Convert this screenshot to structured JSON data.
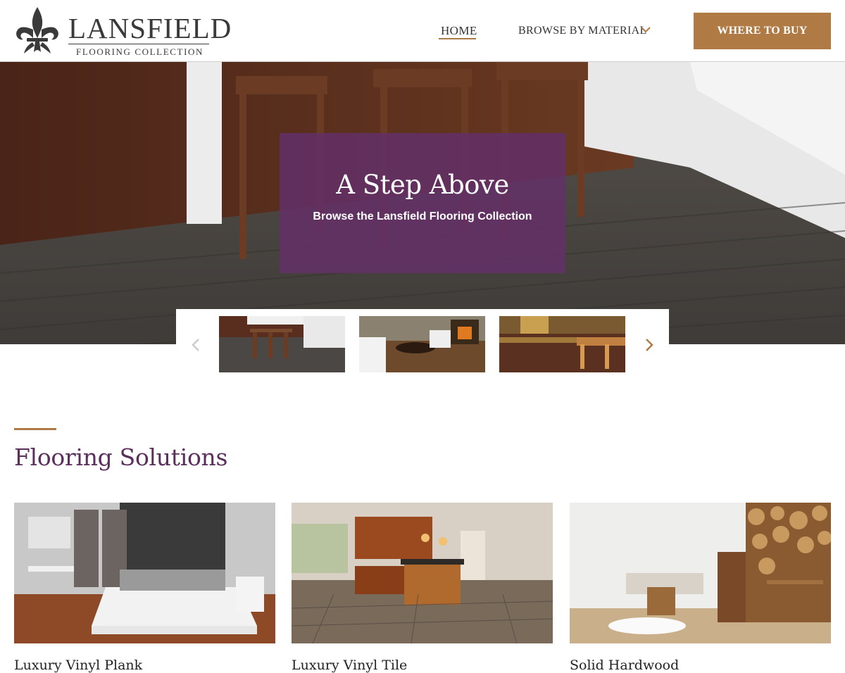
{
  "brand": {
    "name": "LANSFIELD",
    "tagline": "FLOORING COLLECTION"
  },
  "nav": {
    "home": "HOME",
    "browse": "BROWSE BY MATERIAL",
    "where_to_buy": "WHERE TO BUY"
  },
  "hero": {
    "title": "A Step Above",
    "subtitle": "Browse the Lansfield Flooring Collection"
  },
  "section": {
    "title": "Flooring Solutions"
  },
  "cards": [
    {
      "label": "Luxury Vinyl Plank"
    },
    {
      "label": "Luxury Vinyl Tile"
    },
    {
      "label": "Solid Hardwood"
    }
  ],
  "colors": {
    "accent": "#b07a44",
    "purple": "#5a2f5c",
    "hero_overlay": "#633068"
  },
  "icons": {
    "dropdown": "chevron-down-icon",
    "prev": "chevron-left-icon",
    "next": "chevron-right-icon",
    "logo": "fleur-de-lis-icon"
  }
}
